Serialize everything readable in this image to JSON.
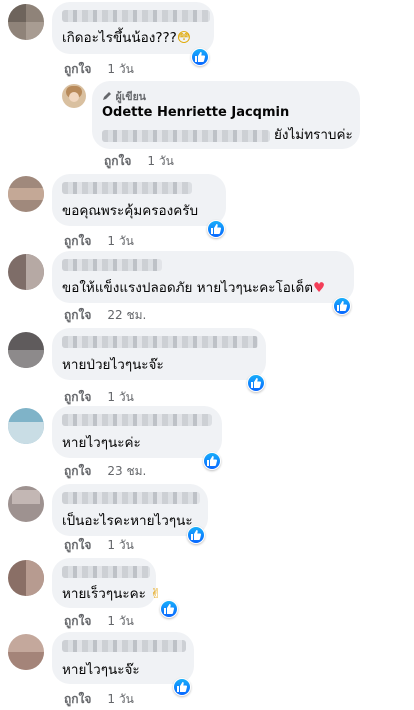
{
  "actions": {
    "like_label": "ถูกใจ"
  },
  "comments": [
    {
      "text": "เกิดอะไรขึ้นน้อง???",
      "emoji": "😳",
      "time": "1 วัน",
      "has_like": true
    },
    {
      "author_badge": "ผู้เขียน",
      "author_name": "Odette Henriette Jacqmin",
      "text": "ยังไม่ทราบค่ะ",
      "time": "1 วัน"
    },
    {
      "text": "ขอคุณพระคุ้มครองครับ",
      "time": "1 วัน",
      "has_like": true
    },
    {
      "text": "ขอให้แข็งแรงปลอดภัย หายไวๆนะคะโอเด็ต",
      "emoji": "♥",
      "time": "22 ชม.",
      "has_like": true
    },
    {
      "text": "หายป่วยไวๆนะจ๊ะ",
      "time": "1 วัน",
      "has_like": true
    },
    {
      "text": "หายไวๆนะค่ะ",
      "time": "23 ชม.",
      "has_like": true
    },
    {
      "text": "เป็นอะไรคะหายไวๆนะ",
      "time": "1 วัน",
      "has_like": true
    },
    {
      "text": "หายเร็วๆนะคะ",
      "emoji": "✌",
      "time": "1 วัน",
      "has_like": true
    },
    {
      "text": "หายไวๆนะจ๊ะ",
      "time": "1 วัน",
      "has_like": true
    }
  ],
  "icons": {
    "like": "thumbs-up-icon",
    "author": "pencil-icon"
  },
  "colors": {
    "bubble": "#f0f2f5",
    "like_blue": "#0866ff",
    "meta_text": "#65676b",
    "heart": "#f33e58"
  }
}
